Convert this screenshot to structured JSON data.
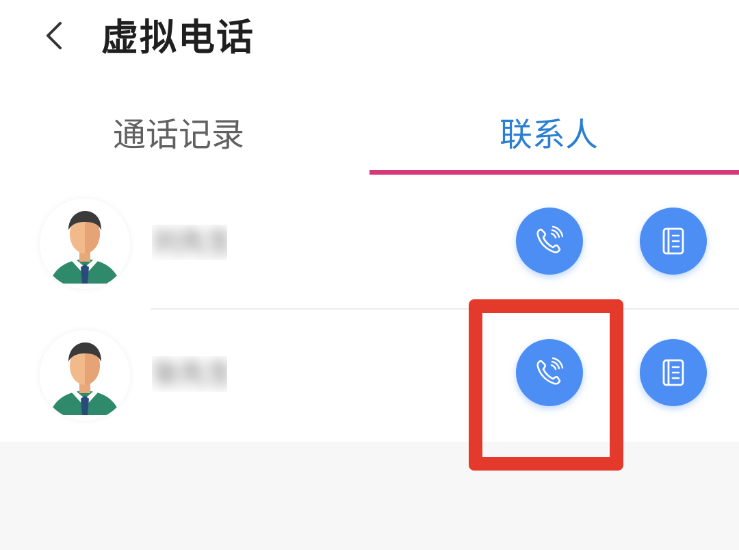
{
  "header": {
    "title": "虚拟电话"
  },
  "tabs": [
    {
      "label": "通话记录",
      "active": false
    },
    {
      "label": "联系人",
      "active": true
    }
  ],
  "colors": {
    "accent_blue": "#2a7fd3",
    "tab_indicator": "#d4397a",
    "button_blue": "#4c8ef4",
    "highlight_red": "#e33a2b"
  },
  "contacts": [
    {
      "name": "刘先生",
      "avatar": "man-avatar-icon",
      "actions": [
        "phone-icon",
        "notebook-icon"
      ]
    },
    {
      "name": "张先生",
      "avatar": "man-avatar-icon",
      "actions": [
        "phone-icon",
        "notebook-icon"
      ]
    }
  ]
}
